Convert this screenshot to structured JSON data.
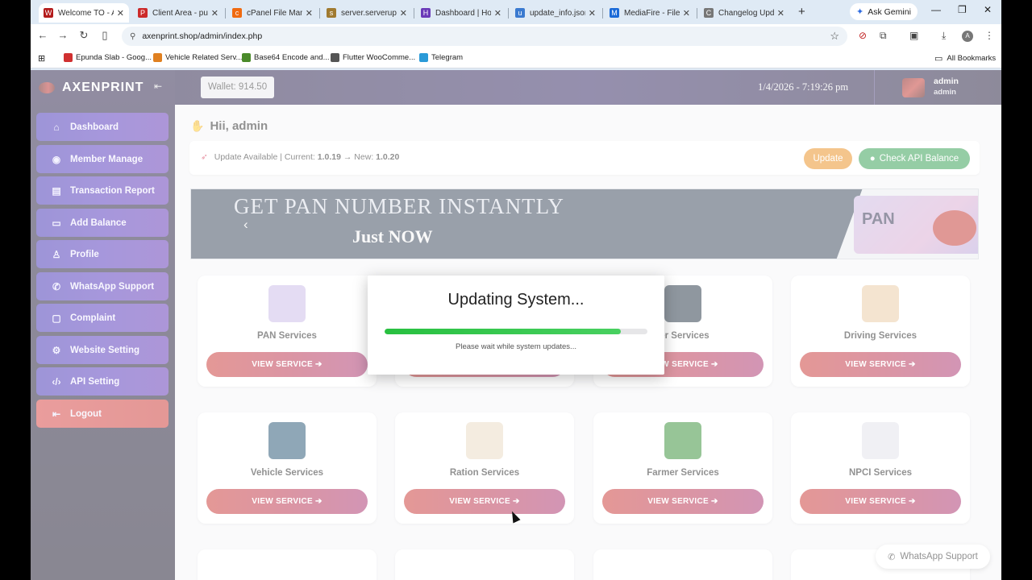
{
  "browser": {
    "tabs": [
      {
        "label": "Welcome TO - AX",
        "color": "#b31b1b",
        "glyph": "W",
        "active": true
      },
      {
        "label": "Client Area - publ",
        "color": "#cc2a2a",
        "glyph": "P",
        "active": false
      },
      {
        "label": "cPanel File Manag",
        "color": "#f06a10",
        "glyph": "c",
        "active": false
      },
      {
        "label": "server.serverup.c",
        "color": "#a07a30",
        "glyph": "s",
        "active": false
      },
      {
        "label": "Dashboard | Host",
        "color": "#6a3ab8",
        "glyph": "H",
        "active": false
      },
      {
        "label": "update_info.json",
        "color": "#3a7ad0",
        "glyph": "u",
        "active": false
      },
      {
        "label": "MediaFire - File s",
        "color": "#1a6ad8",
        "glyph": "M",
        "active": false
      },
      {
        "label": "Changelog Upda",
        "color": "#777777",
        "glyph": "C",
        "active": false
      }
    ],
    "gemini_label": "Ask Gemini",
    "url": "axenprint.shop/admin/index.php",
    "bookmarks": [
      {
        "label": "Epunda Slab - Goog...",
        "color": "#d03030"
      },
      {
        "label": "Vehicle Related Serv...",
        "color": "#e08020"
      },
      {
        "label": "Base64 Encode and...",
        "color": "#4a8a2a"
      },
      {
        "label": "Flutter WooComme...",
        "color": "#555555"
      },
      {
        "label": "Telegram",
        "color": "#2a9ad8"
      }
    ],
    "all_bookmarks_label": "All Bookmarks",
    "profile_initial": "A"
  },
  "sidebar": {
    "brand": "AXENPRINT",
    "items": [
      {
        "label": "Dashboard",
        "icon": "home-icon",
        "glyph": "⌂"
      },
      {
        "label": "Member Manage",
        "icon": "user-circle-icon",
        "glyph": "◉"
      },
      {
        "label": "Transaction Report",
        "icon": "document-icon",
        "glyph": "▤"
      },
      {
        "label": "Add Balance",
        "icon": "wallet-icon",
        "glyph": "▭"
      },
      {
        "label": "Profile",
        "icon": "person-icon",
        "glyph": "♙"
      },
      {
        "label": "WhatsApp Support",
        "icon": "whatsapp-icon",
        "glyph": "✆"
      },
      {
        "label": "Complaint",
        "icon": "message-icon",
        "glyph": "▢"
      },
      {
        "label": "Website Setting",
        "icon": "gear-icon",
        "glyph": "⚙"
      },
      {
        "label": "API Setting",
        "icon": "code-icon",
        "glyph": "‹/›"
      }
    ],
    "logout": {
      "label": "Logout",
      "icon": "logout-icon",
      "glyph": "⇤"
    }
  },
  "topbar": {
    "wallet": "Wallet: 914.50",
    "datetime": "1/4/2026 - 7:19:26 pm",
    "username": "admin",
    "role": "admin"
  },
  "main": {
    "greeting": "Hii, admin",
    "update_bar": {
      "prefix": "Update Available | Current:",
      "current": "1.0.19",
      "arrow": "→ New:",
      "new": "1.0.20",
      "update_button": "Update",
      "api_button": "Check API Balance"
    },
    "banner": {
      "headline": "GET PAN NUMBER INSTANTLY",
      "subline": "Just NOW",
      "card_text": "PAN"
    },
    "services": [
      {
        "title": "PAN Services",
        "icon_color": "#c9b8e6",
        "button": "VIEW SERVICE ➔"
      },
      {
        "title": "",
        "icon_color": "#ffffff",
        "button": "VIEW SERVICE ➔"
      },
      {
        "title": "ter Services",
        "icon_color": "#1f2f3f",
        "button": "VIEW SERVICE ➔"
      },
      {
        "title": "Driving Services",
        "icon_color": "#e8c8a0",
        "button": "VIEW SERVICE ➔"
      },
      {
        "title": "Vehicle Services",
        "icon_color": "#1f4f6f",
        "button": "VIEW SERVICE ➔"
      },
      {
        "title": "Ration Services",
        "icon_color": "#e8d8c0",
        "button": "VIEW SERVICE ➔"
      },
      {
        "title": "Farmer Services",
        "icon_color": "#2f8a2f",
        "button": "VIEW SERVICE ➔"
      },
      {
        "title": "NPCI Services",
        "icon_color": "#e0e0e8",
        "button": "VIEW SERVICE ➔"
      }
    ],
    "whatsapp_float": "WhatsApp Support"
  },
  "modal": {
    "title": "Updating System...",
    "subtitle": "Please wait while system updates...",
    "progress": 0.9
  }
}
